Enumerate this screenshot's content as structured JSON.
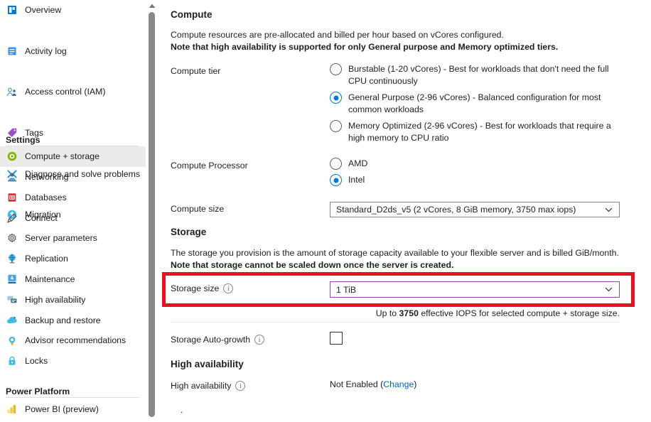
{
  "sidebar": {
    "items": [
      {
        "label": "Overview",
        "icon": "overview-icon",
        "selected": false
      },
      {
        "label": "Activity log",
        "icon": "activity-log-icon",
        "selected": false
      },
      {
        "label": "Access control (IAM)",
        "icon": "access-control-icon",
        "selected": false
      },
      {
        "label": "Tags",
        "icon": "tags-icon",
        "selected": false
      },
      {
        "label": "Diagnose and solve problems",
        "icon": "diagnose-icon",
        "selected": false
      },
      {
        "label": "Migration",
        "icon": "migration-icon",
        "selected": false
      }
    ],
    "settings_group": "Settings",
    "settings_items": [
      {
        "label": "Compute + storage",
        "icon": "compute-storage-icon",
        "selected": true
      },
      {
        "label": "Networking",
        "icon": "networking-icon",
        "selected": false
      },
      {
        "label": "Databases",
        "icon": "databases-icon",
        "selected": false
      },
      {
        "label": "Connect",
        "icon": "connect-icon",
        "selected": false
      },
      {
        "label": "Server parameters",
        "icon": "server-parameters-icon",
        "selected": false
      },
      {
        "label": "Replication",
        "icon": "replication-icon",
        "selected": false
      },
      {
        "label": "Maintenance",
        "icon": "maintenance-icon",
        "selected": false
      },
      {
        "label": "High availability",
        "icon": "high-availability-icon",
        "selected": false
      },
      {
        "label": "Backup and restore",
        "icon": "backup-restore-icon",
        "selected": false
      },
      {
        "label": "Advisor recommendations",
        "icon": "advisor-icon",
        "selected": false
      },
      {
        "label": "Locks",
        "icon": "locks-icon",
        "selected": false
      }
    ],
    "power_platform_group": "Power Platform",
    "power_platform_items": [
      {
        "label": "Power BI (preview)",
        "icon": "power-bi-icon",
        "selected": false
      }
    ]
  },
  "main": {
    "compute": {
      "heading": "Compute",
      "description_line1": "Compute resources are pre-allocated and billed per hour based on vCores configured.",
      "description_line2": "Note that high availability is supported for only General purpose and Memory optimized tiers.",
      "tier_label": "Compute tier",
      "tier_options": [
        {
          "label": "Burstable (1-20 vCores) - Best for workloads that don't need the full CPU continuously",
          "selected": false
        },
        {
          "label": "General Purpose (2-96 vCores) - Balanced configuration for most common workloads",
          "selected": true
        },
        {
          "label": "Memory Optimized (2-96 vCores) - Best for workloads that require a high memory to CPU ratio",
          "selected": false
        }
      ],
      "processor_label": "Compute Processor",
      "processor_options": [
        {
          "label": "AMD",
          "selected": false
        },
        {
          "label": "Intel",
          "selected": true
        }
      ],
      "size_label": "Compute size",
      "size_value": "Standard_D2ds_v5 (2 vCores, 8 GiB memory, 3750 max iops)"
    },
    "storage": {
      "heading": "Storage",
      "description_line1": "The storage you provision is the amount of storage capacity available to your flexible server and is billed GiB/month.",
      "description_line2": "Note that storage cannot be scaled down once the server is created.",
      "size_label": "Storage size",
      "size_value": "1 TiB",
      "iops_hint_prefix": "Up to ",
      "iops_hint_value": "3750",
      "iops_hint_suffix": " effective IOPS for selected compute + storage size.",
      "autogrowth_label": "Storage Auto-growth",
      "autogrowth_checked": false
    },
    "high_availability": {
      "heading": "High availability",
      "field_label": "High availability",
      "value_text": "Not Enabled (",
      "change_link": "Change",
      "value_text_end": ")"
    },
    "bottom_stub": "."
  },
  "colors": {
    "accent": "#0078d4",
    "focus_border": "#8a4ba8",
    "annotation": "#e81123",
    "link": "#0066cc",
    "selected_nav_bg": "#edebe9"
  }
}
